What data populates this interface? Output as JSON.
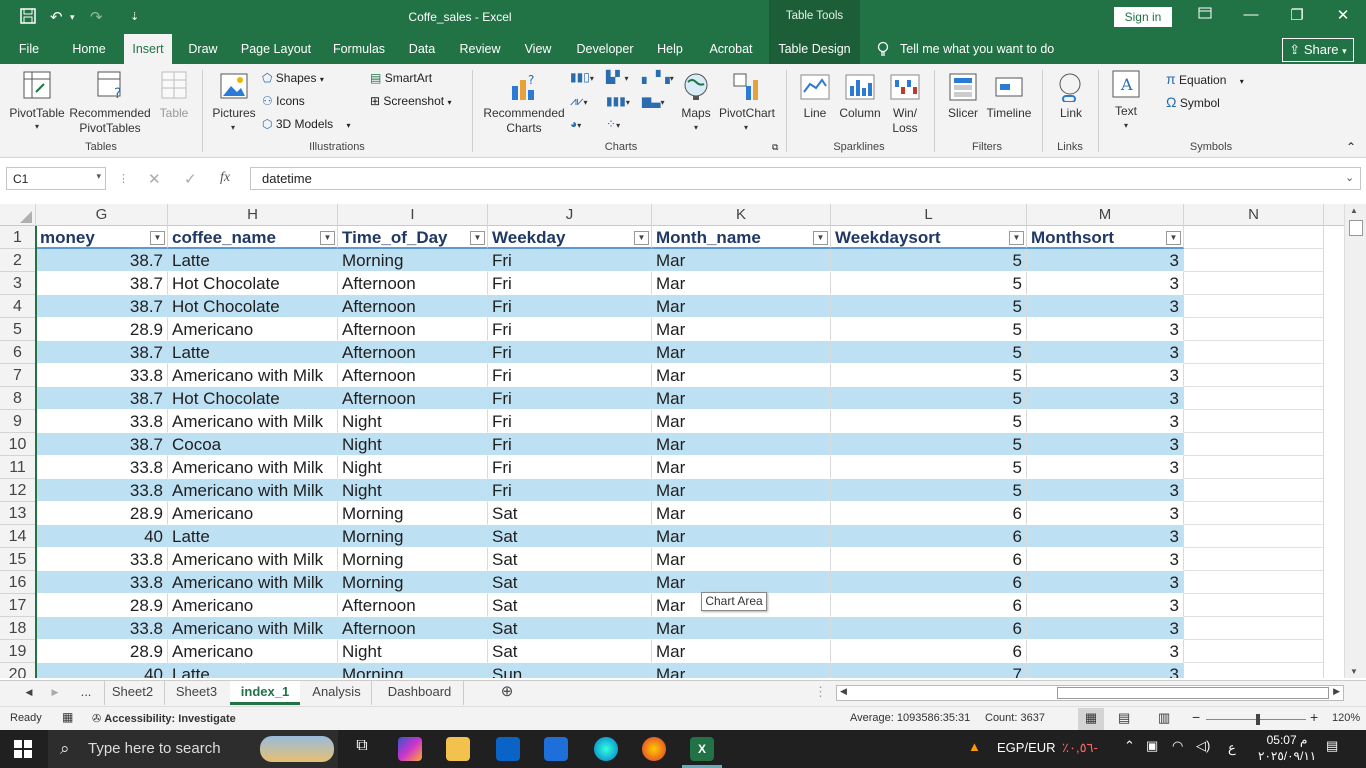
{
  "app": {
    "title": "Coffe_sales  -  Excel",
    "table_tools": "Table Tools",
    "sign_in": "Sign in",
    "share": "Share"
  },
  "ribbon_tabs": [
    "File",
    "Home",
    "Insert",
    "Draw",
    "Page Layout",
    "Formulas",
    "Data",
    "Review",
    "View",
    "Developer",
    "Help",
    "Acrobat",
    "Table Design"
  ],
  "tell_me": "Tell me what you want to do",
  "ribbon": {
    "pivottable": "PivotTable",
    "recommended_pivot": [
      "Recommended",
      "PivotTables"
    ],
    "table": "Table",
    "pictures": "Pictures",
    "shapes": "Shapes",
    "icons": "Icons",
    "models3d": "3D Models",
    "smartart": "SmartArt",
    "screenshot": "Screenshot",
    "recommended_charts": [
      "Recommended",
      "Charts"
    ],
    "maps": "Maps",
    "pivotchart": "PivotChart",
    "line": "Line",
    "column": "Column",
    "winloss": [
      "Win/",
      "Loss"
    ],
    "slicer": "Slicer",
    "timeline": "Timeline",
    "link": "Link",
    "text": "Text",
    "equation": "Equation",
    "symbol": "Symbol",
    "groups": {
      "tables": "Tables",
      "illustrations": "Illustrations",
      "charts": "Charts",
      "sparklines": "Sparklines",
      "filters": "Filters",
      "links": "Links",
      "symbols": "Symbols"
    }
  },
  "formula_bar": {
    "name_box": "C1",
    "fx": "fx",
    "value": "datetime"
  },
  "columns": [
    "G",
    "H",
    "I",
    "J",
    "K",
    "L",
    "M",
    "N"
  ],
  "headers": [
    "money",
    "coffee_name",
    "Time_of_Day",
    "Weekday",
    "Month_name",
    "Weekdaysort",
    "Monthsort"
  ],
  "rows": [
    {
      "n": "1"
    },
    {
      "n": "2",
      "money": "38.7",
      "coffee": "Latte",
      "tod": "Morning",
      "wd": "Fri",
      "mn": "Mar",
      "wds": "5",
      "ms": "3"
    },
    {
      "n": "3",
      "money": "38.7",
      "coffee": "Hot Chocolate",
      "tod": "Afternoon",
      "wd": "Fri",
      "mn": "Mar",
      "wds": "5",
      "ms": "3"
    },
    {
      "n": "4",
      "money": "38.7",
      "coffee": "Hot Chocolate",
      "tod": "Afternoon",
      "wd": "Fri",
      "mn": "Mar",
      "wds": "5",
      "ms": "3"
    },
    {
      "n": "5",
      "money": "28.9",
      "coffee": "Americano",
      "tod": "Afternoon",
      "wd": "Fri",
      "mn": "Mar",
      "wds": "5",
      "ms": "3"
    },
    {
      "n": "6",
      "money": "38.7",
      "coffee": "Latte",
      "tod": "Afternoon",
      "wd": "Fri",
      "mn": "Mar",
      "wds": "5",
      "ms": "3"
    },
    {
      "n": "7",
      "money": "33.8",
      "coffee": "Americano with Milk",
      "tod": "Afternoon",
      "wd": "Fri",
      "mn": "Mar",
      "wds": "5",
      "ms": "3"
    },
    {
      "n": "8",
      "money": "38.7",
      "coffee": "Hot Chocolate",
      "tod": "Afternoon",
      "wd": "Fri",
      "mn": "Mar",
      "wds": "5",
      "ms": "3"
    },
    {
      "n": "9",
      "money": "33.8",
      "coffee": "Americano with Milk",
      "tod": "Night",
      "wd": "Fri",
      "mn": "Mar",
      "wds": "5",
      "ms": "3"
    },
    {
      "n": "10",
      "money": "38.7",
      "coffee": "Cocoa",
      "tod": "Night",
      "wd": "Fri",
      "mn": "Mar",
      "wds": "5",
      "ms": "3"
    },
    {
      "n": "11",
      "money": "33.8",
      "coffee": "Americano with Milk",
      "tod": "Night",
      "wd": "Fri",
      "mn": "Mar",
      "wds": "5",
      "ms": "3"
    },
    {
      "n": "12",
      "money": "33.8",
      "coffee": "Americano with Milk",
      "tod": "Night",
      "wd": "Fri",
      "mn": "Mar",
      "wds": "5",
      "ms": "3"
    },
    {
      "n": "13",
      "money": "28.9",
      "coffee": "Americano",
      "tod": "Morning",
      "wd": "Sat",
      "mn": "Mar",
      "wds": "6",
      "ms": "3"
    },
    {
      "n": "14",
      "money": "40",
      "coffee": "Latte",
      "tod": "Morning",
      "wd": "Sat",
      "mn": "Mar",
      "wds": "6",
      "ms": "3"
    },
    {
      "n": "15",
      "money": "33.8",
      "coffee": "Americano with Milk",
      "tod": "Morning",
      "wd": "Sat",
      "mn": "Mar",
      "wds": "6",
      "ms": "3"
    },
    {
      "n": "16",
      "money": "33.8",
      "coffee": "Americano with Milk",
      "tod": "Morning",
      "wd": "Sat",
      "mn": "Mar",
      "wds": "6",
      "ms": "3"
    },
    {
      "n": "17",
      "money": "28.9",
      "coffee": "Americano",
      "tod": "Afternoon",
      "wd": "Sat",
      "mn": "Mar",
      "wds": "6",
      "ms": "3"
    },
    {
      "n": "18",
      "money": "33.8",
      "coffee": "Americano with Milk",
      "tod": "Afternoon",
      "wd": "Sat",
      "mn": "Mar",
      "wds": "6",
      "ms": "3"
    },
    {
      "n": "19",
      "money": "28.9",
      "coffee": "Americano",
      "tod": "Night",
      "wd": "Sat",
      "mn": "Mar",
      "wds": "6",
      "ms": "3"
    },
    {
      "n": "20",
      "money": "40",
      "coffee": "Latte",
      "tod": "Morning",
      "wd": "Sun",
      "mn": "Mar",
      "wds": "7",
      "ms": "3"
    }
  ],
  "tooltip": "Chart Area",
  "sheet_tabs": [
    "...",
    "Sheet2",
    "Sheet3",
    "index_1",
    "Analysis",
    "Dashboard"
  ],
  "active_sheet": "index_1",
  "status": {
    "ready": "Ready",
    "accessibility": "Accessibility: Investigate",
    "average": "Average: 1093586:35:31",
    "count": "Count: 3637",
    "zoom": "120%"
  },
  "taskbar": {
    "search": "Type here to search",
    "currency": "EGP/EUR",
    "currency_change": "٪٠,٥٦-",
    "lang": "ع",
    "time": "05:07 م",
    "date": "٢٠٢٥/٠٩/١١"
  },
  "colors": {
    "excel_green": "#217346",
    "band": "#ddebf7",
    "band_light": "#bde0f3",
    "header_text": "#1f3864"
  }
}
